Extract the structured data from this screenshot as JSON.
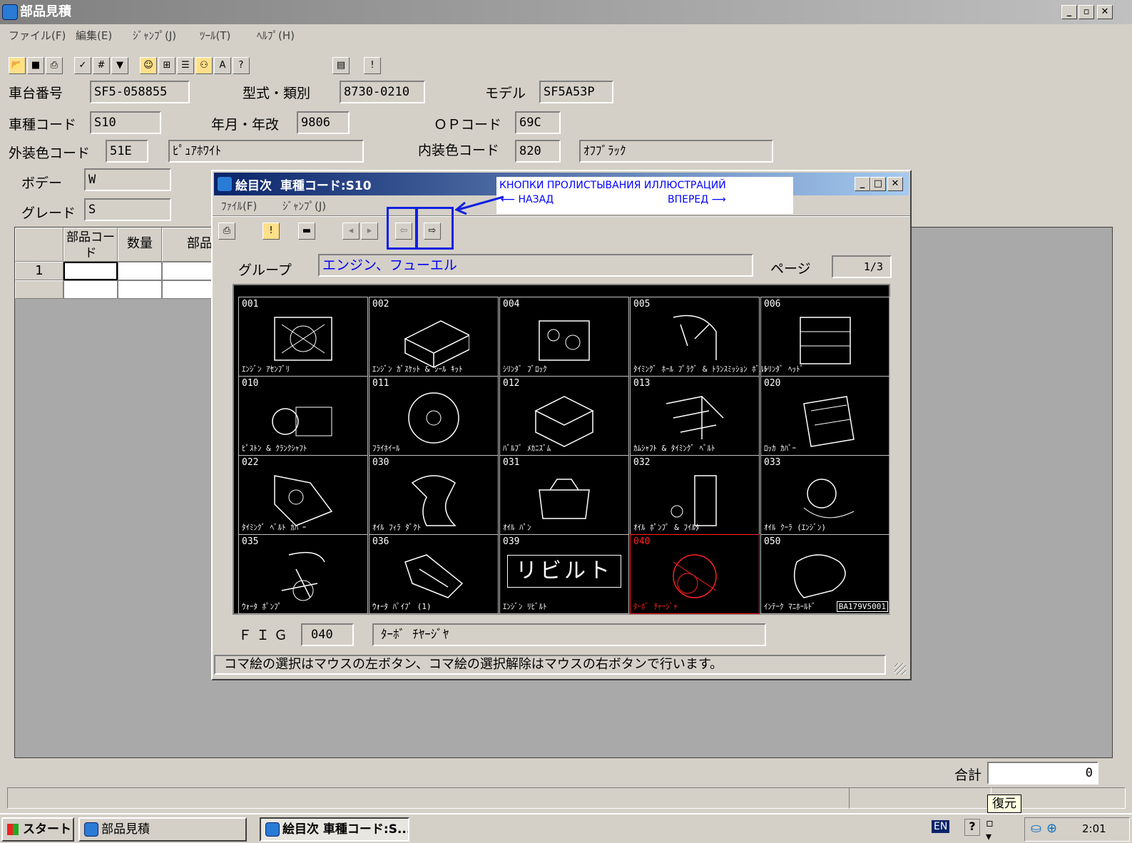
{
  "main_window": {
    "title": "部品見積",
    "menu": [
      "ファイル(F)",
      "編集(E)",
      "ｼﾞｬﾝﾌﾟ(J)",
      "ﾂｰﾙ(T)",
      "ﾍﾙﾌﾟ(H)"
    ],
    "fields": {
      "chassis_label": "車台番号",
      "chassis_value": "SF5-058855",
      "model_type_label": "型式・類別",
      "model_type_value": "8730-0210",
      "model_label": "モデル",
      "model_value": "SF5A53P",
      "vehicle_code_label": "車種コード",
      "vehicle_code_value": "S10",
      "year_label": "年月・年改",
      "year_value": "9806",
      "op_code_label": "ＯＰコード",
      "op_code_value": "69C",
      "ext_color_label": "外装色コード",
      "ext_color_code": "51E",
      "ext_color_name": "ﾋﾟｭｱﾎﾜｲﾄ",
      "int_color_label": "内装色コード",
      "int_color_code": "820",
      "int_color_name": "ｵﾌﾌﾞﾗｯｸ",
      "body_label": "ボデー",
      "body_value": "W",
      "grade_label": "グレード",
      "grade_value": "S"
    },
    "grid_headers": [
      "部品コード",
      "数量",
      "部品"
    ],
    "grid_row": "1",
    "total_label": "合計",
    "total_value": "0"
  },
  "dialog": {
    "title": "絵目次  車種コード:S10",
    "menu": [
      "ﾌｧｲﾙ(F)",
      "ｼﾞｬﾝﾌﾟ(J)"
    ],
    "group_label": "グループ",
    "group_value": "エンジン、フューエル",
    "page_label": "ページ",
    "page_value": "1/3",
    "fig_label": "ＦＩＧ",
    "fig_value": "040",
    "fig_name": "ﾀｰﾎﾞ ﾁﾔｰｼﾞﾔ",
    "status_text": "コマ絵の選択はマウスの左ボタン、コマ絵の選択解除はマウスの右ボタンで行います。",
    "tiles": [
      {
        "num": "001",
        "caption": "ｴﾝｼﾞﾝ ｱｾﾝﾌﾞﾘ"
      },
      {
        "num": "002",
        "caption": "ｴﾝｼﾞﾝ ｶﾞｽｹｯﾄ & ｼｰﾙ ｷｯﾄ"
      },
      {
        "num": "004",
        "caption": "ｼﾘﾝﾀﾞ ﾌﾞﾛｯｸ"
      },
      {
        "num": "005",
        "caption": "ﾀｲﾐﾝｸﾞ ﾎｰﾙ ﾌﾟﾗｸﾞ & ﾄﾗﾝｽﾐｯｼｮﾝ ﾎﾞﾙﾄ"
      },
      {
        "num": "006",
        "caption": "ｼﾘﾝﾀﾞ ﾍｯﾄﾞ"
      },
      {
        "num": "010",
        "caption": "ﾋﾟｽﾄﾝ & ｸﾗﾝｸｼｬﾌﾄ"
      },
      {
        "num": "011",
        "caption": "ﾌﾗｲﾎｲｰﾙ"
      },
      {
        "num": "012",
        "caption": "ﾊﾞﾙﾌﾞ ﾒｶﾆｽﾞﾑ"
      },
      {
        "num": "013",
        "caption": "ｶﾑｼｬﾌﾄ & ﾀｲﾐﾝｸﾞ ﾍﾞﾙﾄ"
      },
      {
        "num": "020",
        "caption": "ﾛｯｶ ｶﾊﾞｰ"
      },
      {
        "num": "022",
        "caption": "ﾀｲﾐﾝｸﾞ ﾍﾞﾙﾄ ｶﾊﾞｰ"
      },
      {
        "num": "030",
        "caption": "ｵｲﾙ ﾌｨﾗ ﾀﾞｸﾄ"
      },
      {
        "num": "031",
        "caption": "ｵｲﾙ ﾊﾟﾝ"
      },
      {
        "num": "032",
        "caption": "ｵｲﾙ ﾎﾟﾝﾌﾟ & ﾌｲﾙﾀ"
      },
      {
        "num": "033",
        "caption": "ｵｲﾙ ｸｰﾗ (ｴﾝｼﾞﾝ)"
      },
      {
        "num": "035",
        "caption": "ｳｫｰﾀ ﾎﾟﾝﾌﾟ"
      },
      {
        "num": "036",
        "caption": "ｳｫｰﾀ ﾊﾟｲﾌﾟ (1)"
      },
      {
        "num": "039",
        "caption": "ｴﾝｼﾞﾝ ﾘﾋﾞﾙﾄ"
      },
      {
        "num": "040",
        "caption": "ﾀｰﾎﾞ ﾁｬｰｼﾞｬ"
      },
      {
        "num": "050",
        "caption": "ｲﾝﾃｰｸ ﾏﾆﾎｰﾙﾄﾞ"
      }
    ],
    "rebuilt_text": "リビルト",
    "figure_code": "BA179V5001"
  },
  "annotation": {
    "title": "КНОПКИ ПРОЛИСТЫВАНИЯ ИЛЛЮСТРАЦИЙ",
    "back": "НАЗАД",
    "forward": "ВПЕРЕД"
  },
  "taskbar": {
    "start": "スタート",
    "task1": "部品見積",
    "task2": "絵目次  車種コード:S...",
    "tooltip": "復元",
    "lang": "EN",
    "clock": "2:01"
  },
  "colors": {
    "titlebar": "#0a246a",
    "selected_tile": "#ff2020",
    "annotation": "#0000ff"
  }
}
